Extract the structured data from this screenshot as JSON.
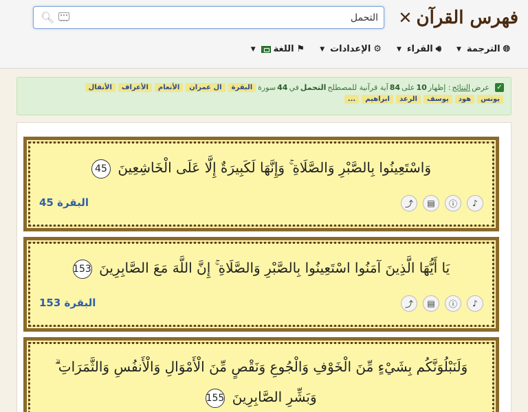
{
  "header": {
    "brand_title": "فهرس القرآن",
    "search_value": "التحمل"
  },
  "menu": [
    {
      "label": "الترجمة",
      "icon": "globe-icon"
    },
    {
      "label": "القراء",
      "icon": "speaker-icon"
    },
    {
      "label": "الإعدادات",
      "icon": "gear-icon"
    },
    {
      "label": "اللغة",
      "icon": "flag-icon"
    }
  ],
  "alert": {
    "prefix": "عرض",
    "results_word": "النتائج",
    "showing": ": إظهار",
    "shown": "10",
    "of_word": "على",
    "total": "84",
    "verses_text": "آية قرآنية للمصطلح",
    "term": "التحمل",
    "in_word": "في",
    "surah_count": "44",
    "surah_word": "سورة",
    "tags_line1": [
      "البقرة",
      "ال عمران",
      "الأنعام",
      "الأعراف",
      "الأنفال"
    ],
    "tags_line2": [
      "يونس",
      "هود",
      "يوسف",
      "الرعد",
      "ابراهيم",
      "..."
    ]
  },
  "verses": [
    {
      "text": "وَاسْتَعِينُوا بِالصَّبْرِ وَالصَّلَاةِ ۚ وَإِنَّهَا لَكَبِيرَةٌ إِلَّا عَلَى الْخَاشِعِينَ",
      "number": "45",
      "reference": "البقرة 45"
    },
    {
      "text": "يَا أَيُّهَا الَّذِينَ آمَنُوا اسْتَعِينُوا بِالصَّبْرِ وَالصَّلَاةِ ۚ إِنَّ اللَّهَ مَعَ الصَّابِرِينَ",
      "number": "153",
      "reference": "البقرة 153"
    },
    {
      "text": "وَلَنَبْلُوَنَّكُم بِشَيْءٍ مِّنَ الْخَوْفِ وَالْجُوعِ وَنَقْصٍ مِّنَ الْأَمْوَالِ وَالْأَنفُسِ وَالثَّمَرَاتِ ۗ وَبَشِّرِ الصَّابِرِينَ",
      "number": "155",
      "reference": ""
    }
  ]
}
